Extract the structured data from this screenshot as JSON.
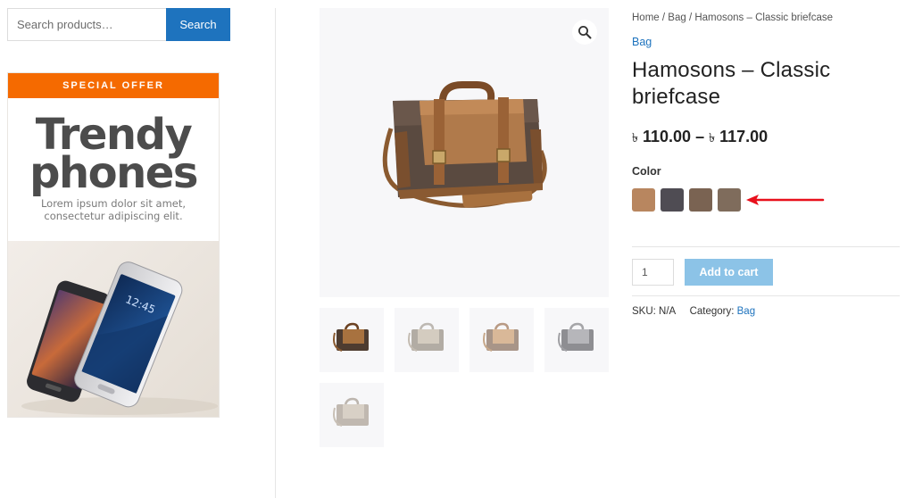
{
  "search": {
    "placeholder": "Search products…",
    "button_label": "Search"
  },
  "promo": {
    "header": "SPECIAL OFFER",
    "title_line1": "Trendy",
    "title_line2": "phones",
    "subtitle_line1": "Lorem ipsum dolor sit amet,",
    "subtitle_line2": "consectetur adipiscing elit."
  },
  "breadcrumb": {
    "home": "Home",
    "sep": " / ",
    "category": "Bag",
    "current": "Hamosons – Classic briefcase"
  },
  "product": {
    "category_link": "Bag",
    "title_line1": "Hamosons – Classic",
    "title_line2": "briefcase",
    "currency": "৳",
    "price_low": "110.00",
    "price_dash": " – ",
    "price_high": "117.00",
    "color_label": "Color",
    "swatches": [
      {
        "name": "light-brown",
        "color": "#b8865f"
      },
      {
        "name": "dark-grey",
        "color": "#4f4c53"
      },
      {
        "name": "brown",
        "color": "#7a6352"
      },
      {
        "name": "olive-brown",
        "color": "#7f6c5c"
      }
    ],
    "quantity": "1",
    "add_to_cart": "Add to cart",
    "sku_label": "SKU:",
    "sku_value": "N/A",
    "category_label": "Category:",
    "category_value": "Bag"
  },
  "colors": {
    "accent_blue": "#1e73be",
    "promo_orange": "#f56a00",
    "add_to_cart_bg": "#8cc3e7",
    "arrow_red": "#e8101c"
  }
}
